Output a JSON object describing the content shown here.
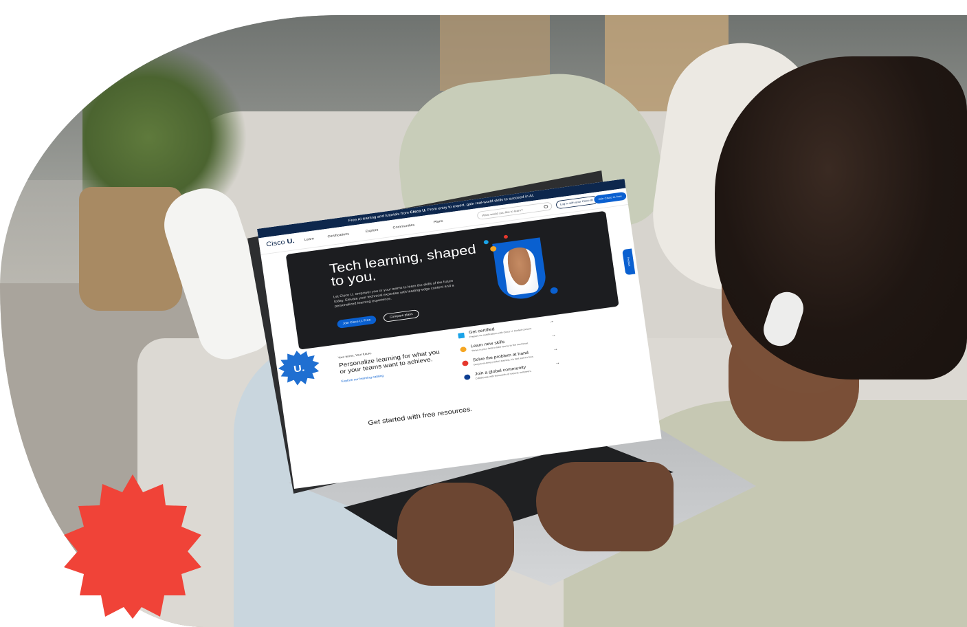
{
  "promo": {
    "text_before": "Free AI training and tutorials from ",
    "brand": "Cisco U.",
    "text_after": " From entry to expert, gain real-world skills to succeed in AI."
  },
  "nav": {
    "logo_word": "Cisco",
    "logo_mark": "U.",
    "items": [
      "Learn",
      "Certifications",
      "Explore",
      "Communities",
      "Plans"
    ],
    "search_placeholder": "What would you like to learn?",
    "login_label": "Log in with your Cisco ID",
    "join_label": "Join Cisco U. free"
  },
  "hero": {
    "title": "Tech learning, shaped to you.",
    "description": "Let Cisco U. empower you or your teams to learn the skills of the future today. Elevate your technical expertise with leading-edge content and a personalized learning experience.",
    "primary_button": "Join Cisco U. Free",
    "secondary_button": "Compare plans"
  },
  "badge": {
    "mark": "U."
  },
  "personalize": {
    "kicker": "Your terms. Your future.",
    "title": "Personalize learning for what you or your teams want to achieve.",
    "link": "Explore our learning catalog"
  },
  "features": [
    {
      "title": "Get certified",
      "desc": "Prepare for certifications with Cisco U. trusted content.",
      "color": "#1aa3e8",
      "shape": "square-icon"
    },
    {
      "title": "Learn new skills",
      "desc": "Thrive in your field or take teams to the next level.",
      "color": "#f5a623",
      "shape": "circle-icon"
    },
    {
      "title": "Solve the problem at hand",
      "desc": "Get just-in-time product training. It's fast and it's free.",
      "color": "#e5372d",
      "shape": "circle-icon"
    },
    {
      "title": "Join a global community",
      "desc": "Collaborate with thousands of experts and peers.",
      "color": "#0d3e91",
      "shape": "circle-icon"
    }
  ],
  "feedback_label": "Feedback",
  "free_resources_title": "Get started with free resources.",
  "colors": {
    "brand_navy": "#0d274d",
    "brand_blue": "#0a60d0",
    "accent_red": "#f04338"
  }
}
